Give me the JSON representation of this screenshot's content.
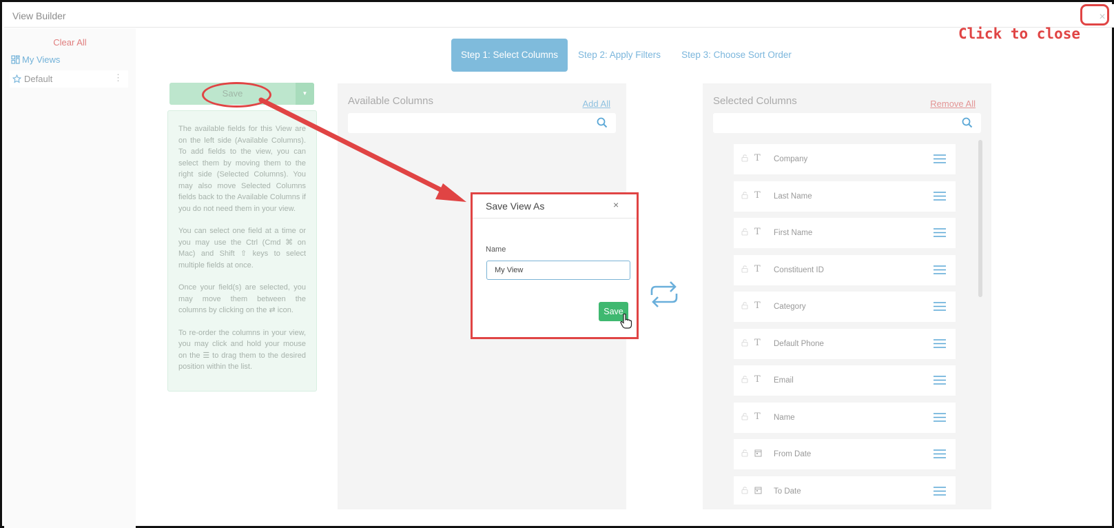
{
  "window": {
    "title": "View Builder",
    "close_glyph": "×"
  },
  "annotation": {
    "close_note": "Click to close",
    "color": "#e04444"
  },
  "sidebar": {
    "clear_all": "Clear All",
    "my_views": "My Views",
    "items": [
      {
        "label": "Default",
        "icon": "star-icon"
      }
    ]
  },
  "steps": [
    {
      "label": "Step 1: Select Columns",
      "active": true
    },
    {
      "label": "Step 2: Apply Filters",
      "active": false
    },
    {
      "label": "Step 3: Choose Sort Order",
      "active": false
    }
  ],
  "save_button": {
    "label": "Save"
  },
  "help": {
    "paragraphs": [
      "The available fields for this View are on the left side (Available Columns). To add fields to the view, you can select them by moving them to the right side (Selected Columns). You may also move Selected Columns fields back to the Available Columns if you do not need them in your view.",
      "You can select one field at a time or you may use the Ctrl (Cmd ⌘ on Mac) and Shift ⇧ keys to select multiple fields at once.",
      "Once your field(s) are selected, you may move them between the columns by clicking on the ⇄ icon.",
      "To re-order the columns in your view, you may click and hold your mouse on the ☰ to drag them to the desired position within the list."
    ]
  },
  "available_columns": {
    "title": "Available Columns",
    "add_all": "Add All",
    "search_placeholder": ""
  },
  "selected_columns": {
    "title": "Selected Columns",
    "remove_all": "Remove All",
    "search_placeholder": "",
    "items": [
      {
        "label": "Company",
        "type": "text"
      },
      {
        "label": "Last Name",
        "type": "text"
      },
      {
        "label": "First Name",
        "type": "text"
      },
      {
        "label": "Constituent ID",
        "type": "text"
      },
      {
        "label": "Category",
        "type": "text"
      },
      {
        "label": "Default Phone",
        "type": "text"
      },
      {
        "label": "Email",
        "type": "text"
      },
      {
        "label": "Name",
        "type": "text"
      },
      {
        "label": "From Date",
        "type": "date"
      },
      {
        "label": "To Date",
        "type": "date"
      }
    ]
  },
  "modal": {
    "title": "Save View As",
    "close": "×",
    "name_label": "Name",
    "name_value": "My View",
    "save_label": "Save"
  },
  "colors": {
    "accent": "#7fbbdc",
    "success": "#3fb870",
    "annotation": "#e04444"
  }
}
